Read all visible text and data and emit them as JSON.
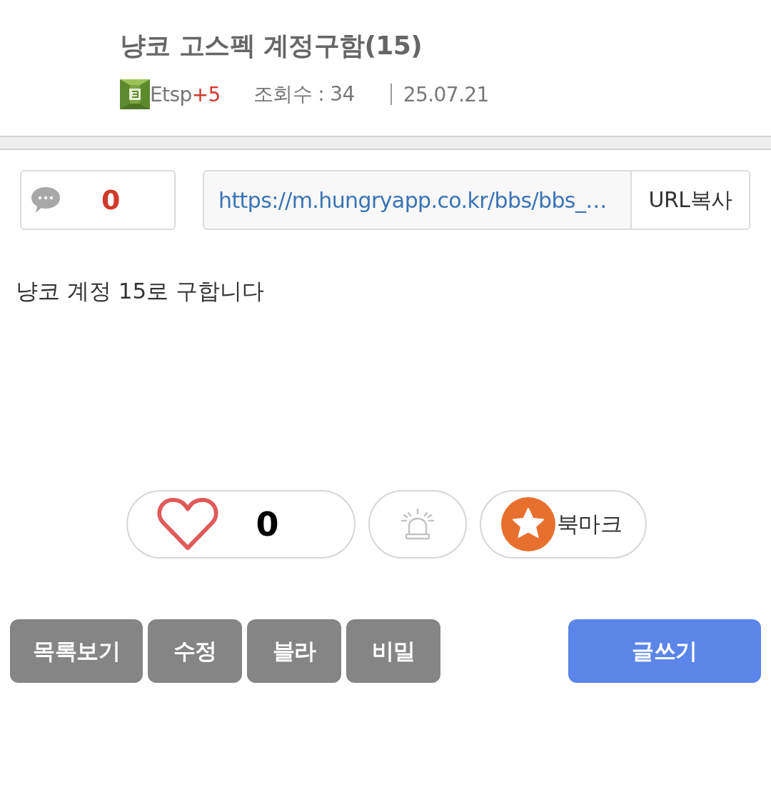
{
  "post": {
    "title": "냥코 고스펙 계정구함(15)",
    "author": {
      "name": "Etsp",
      "level": "+5"
    },
    "views": "조회수 : 34",
    "date": "25.07.21"
  },
  "share": {
    "comment_count": "0",
    "url": "https://m.hungryapp.co.kr/bbs/bbs_…",
    "copy_button": "URL복사"
  },
  "body": "냥코 계정 15로 구합니다",
  "reactions": {
    "like_count": "0",
    "bookmark_label": "북마크"
  },
  "actions": [
    {
      "label": "목록보기",
      "kind": "secondary"
    },
    {
      "label": "수정",
      "kind": "secondary"
    },
    {
      "label": "블라",
      "kind": "secondary"
    },
    {
      "label": "비밀",
      "kind": "secondary"
    },
    {
      "label": "글쓰기",
      "kind": "primary"
    }
  ]
}
